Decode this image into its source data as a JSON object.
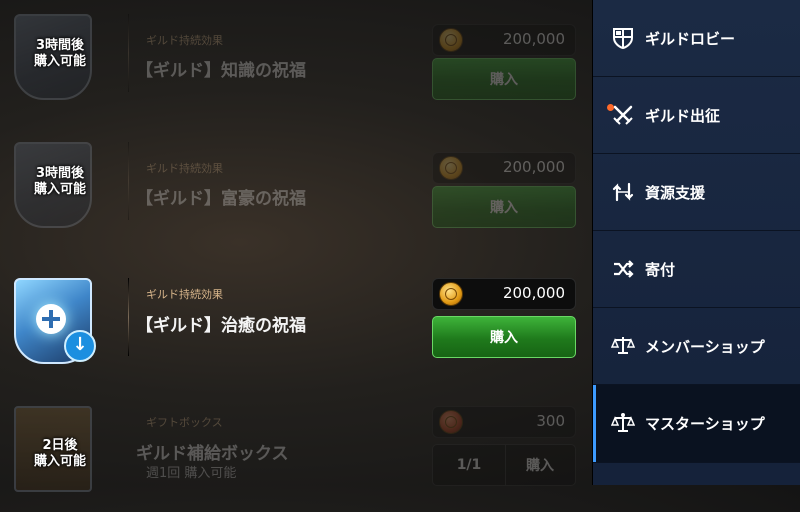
{
  "currency_colors": {
    "gold": "#e29a14",
    "accent_green": "#2f9c2b",
    "sidebar": "#1b2a44",
    "active_bar": "#3d9bff"
  },
  "rows": [
    {
      "overlay_line1": "3時間後",
      "overlay_line2": "購入可能",
      "category": "ギルド持続効果",
      "title": "【ギルド】知識の祝福",
      "price": "200,000",
      "buy_label": "購入",
      "icon": "shield-icon"
    },
    {
      "overlay_line1": "3時間後",
      "overlay_line2": "購入可能",
      "category": "ギルド持続効果",
      "title": "【ギルド】富豪の祝福",
      "price": "200,000",
      "buy_label": "購入",
      "icon": "shield-icon"
    },
    {
      "category": "ギルド持続効果",
      "title": "【ギルド】治癒の祝福",
      "price": "200,000",
      "buy_label": "購入",
      "icon": "healing-shield-icon"
    },
    {
      "overlay_line1": "2日後",
      "overlay_line2": "購入可能",
      "category": "ギフトボックス",
      "title": "ギルド補給ボックス",
      "subtitle": "週1回 購入可能",
      "price": "300",
      "count": "1/1",
      "buy_label": "購入",
      "icon": "gift-box-icon"
    }
  ],
  "sidebar": {
    "items": [
      {
        "label": "ギルドロビー",
        "icon": "guild-crest-icon"
      },
      {
        "label": "ギルド出征",
        "icon": "crossed-swords-icon",
        "badge": "notification-dot"
      },
      {
        "label": "資源支援",
        "icon": "support-arrows-icon"
      },
      {
        "label": "寄付",
        "icon": "shuffle-icon"
      },
      {
        "label": "メンバーショップ",
        "icon": "scales-icon"
      },
      {
        "label": "マスターショップ",
        "icon": "master-scales-icon",
        "active": true
      }
    ]
  }
}
